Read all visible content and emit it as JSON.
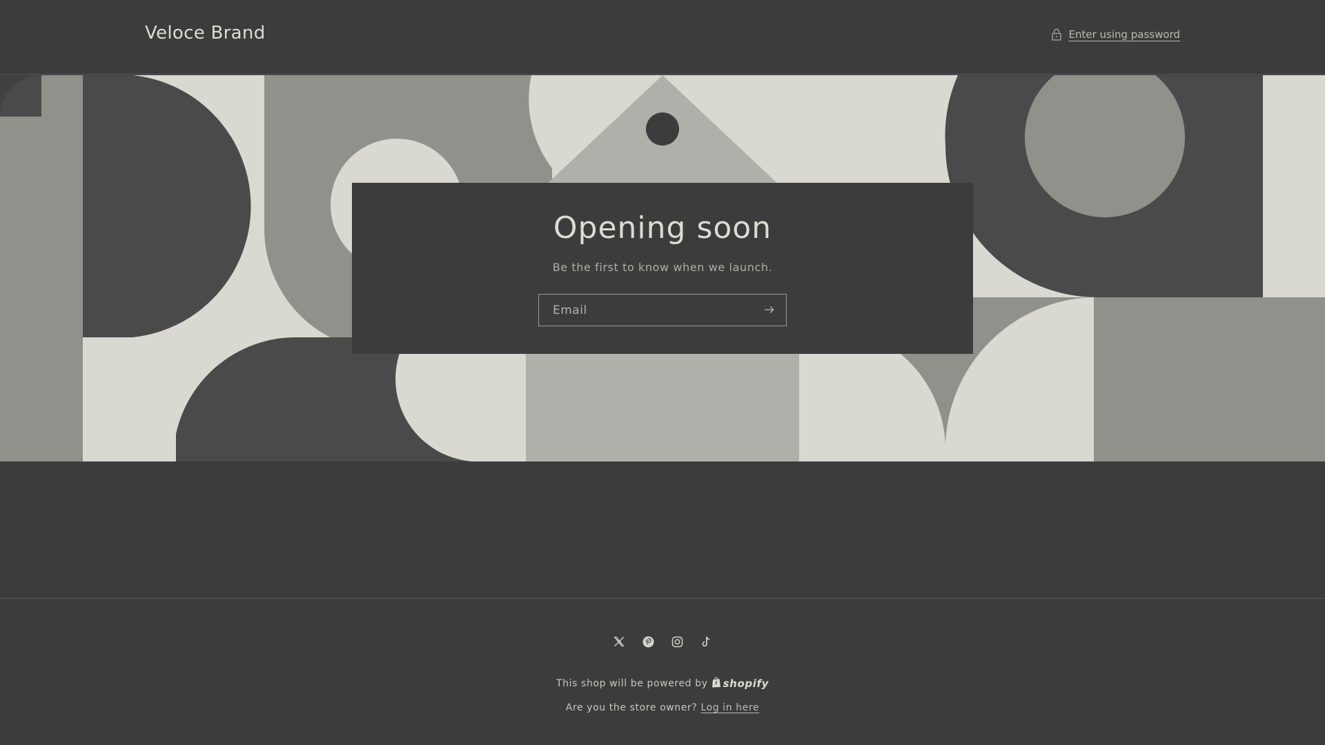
{
  "header": {
    "brand": "Veloce Brand",
    "password_link": "Enter using password",
    "password_icon": "lock-icon"
  },
  "banner": {
    "palette": {
      "light": "#d9d9d2",
      "mid": "#b0b0aa",
      "gray": "#91918c",
      "dark": "#4a4a4a"
    }
  },
  "card": {
    "title": "Opening soon",
    "subtitle": "Be the first to know when we launch.",
    "email_placeholder": "Email",
    "submit_icon": "arrow-right-icon"
  },
  "footer": {
    "socials": [
      {
        "name": "x-icon"
      },
      {
        "name": "pinterest-icon"
      },
      {
        "name": "instagram-icon"
      },
      {
        "name": "tiktok-icon"
      }
    ],
    "powered_text": "This shop will be powered by",
    "shopify_label": "shopify",
    "owner_text": "Are you the store owner?",
    "login_link": "Log in here"
  },
  "colors": {
    "background": "#3c3c3c",
    "text": "#d4d4cf"
  }
}
